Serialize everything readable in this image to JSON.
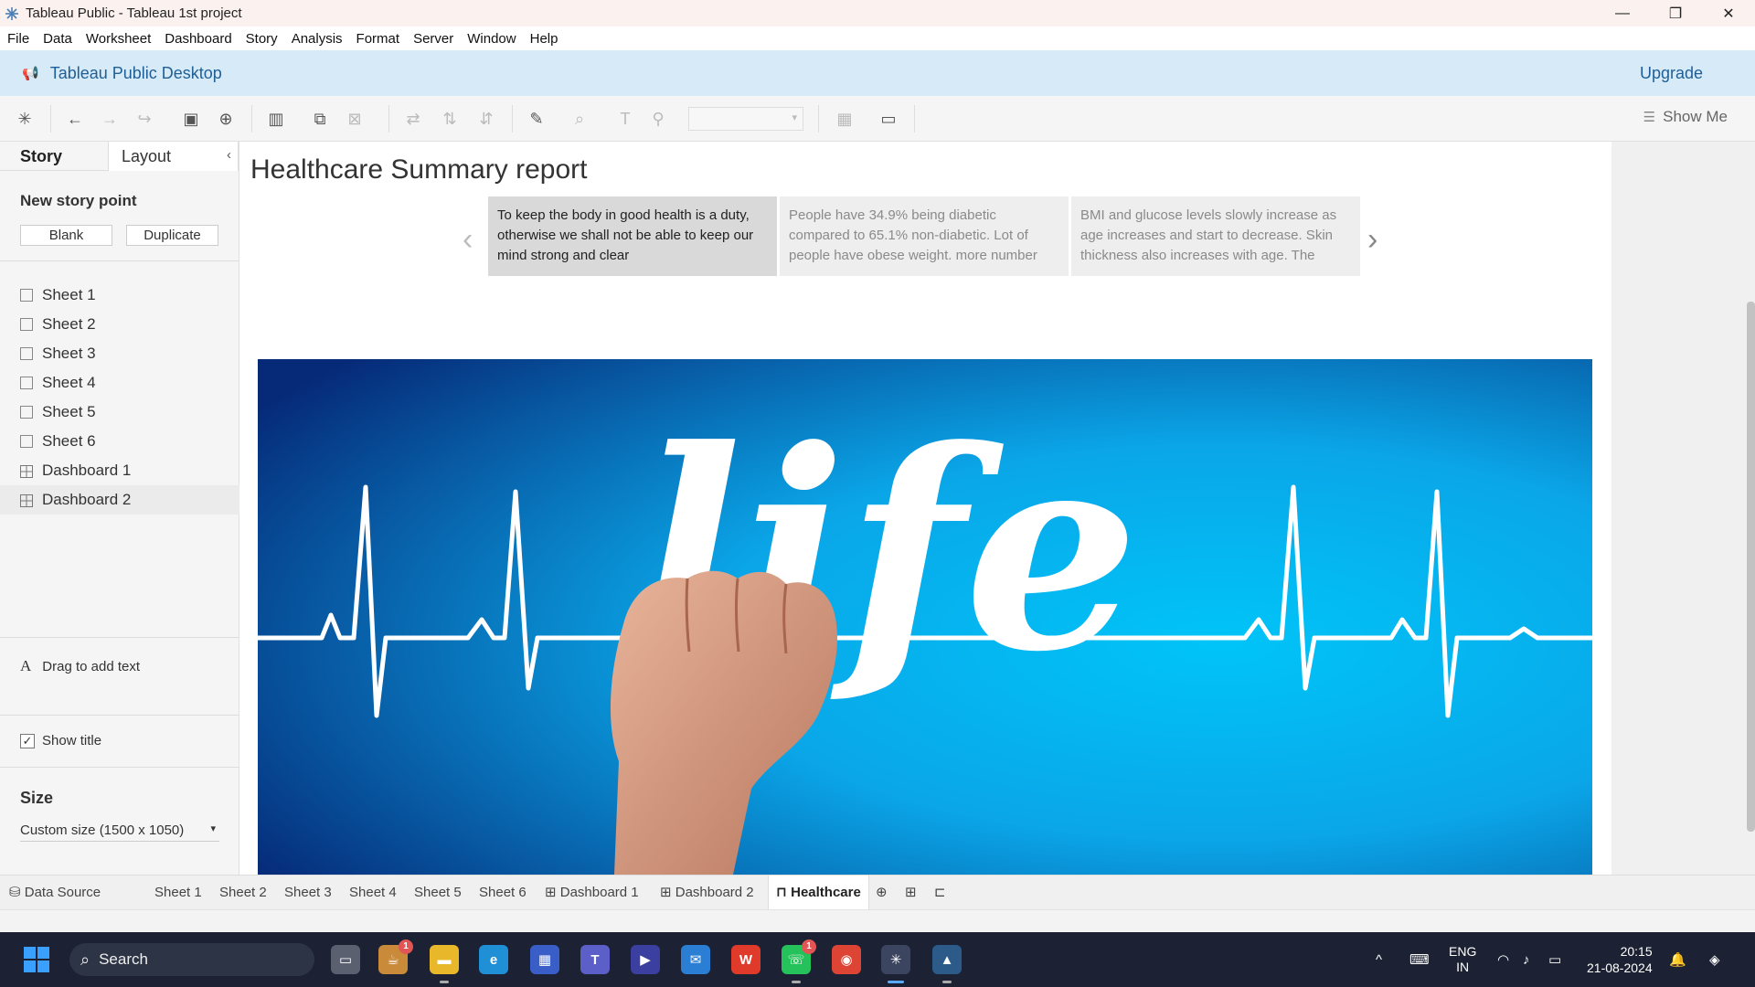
{
  "window": {
    "title": "Tableau Public - Tableau 1st project",
    "controls": [
      "minimize",
      "restore",
      "close"
    ]
  },
  "menu": [
    "File",
    "Data",
    "Worksheet",
    "Dashboard",
    "Story",
    "Analysis",
    "Format",
    "Server",
    "Window",
    "Help"
  ],
  "banner": {
    "name": "Tableau Public Desktop",
    "upgrade": "Upgrade"
  },
  "toolbar": {
    "show_me": "Show Me"
  },
  "left_panel": {
    "tabs": [
      "Story",
      "Layout"
    ],
    "new_story_point": "New story point",
    "blank_button": "Blank",
    "duplicate_button": "Duplicate",
    "sheets": [
      {
        "label": "Sheet 1",
        "type": "worksheet"
      },
      {
        "label": "Sheet 2",
        "type": "worksheet"
      },
      {
        "label": "Sheet 3",
        "type": "worksheet"
      },
      {
        "label": "Sheet 4",
        "type": "worksheet"
      },
      {
        "label": "Sheet 5",
        "type": "worksheet"
      },
      {
        "label": "Sheet 6",
        "type": "worksheet"
      },
      {
        "label": "Dashboard 1",
        "type": "dashboard"
      },
      {
        "label": "Dashboard 2",
        "type": "dashboard"
      }
    ],
    "drag_text": "Drag to add text",
    "show_title": "Show title",
    "show_title_checked": true,
    "size_heading": "Size",
    "size_value": "Custom size (1500 x 1050)"
  },
  "story": {
    "title": "Healthcare Summary report",
    "points": [
      {
        "text": "To keep the body in good health is a duty, otherwise we shall not be able to keep our mind strong and clear",
        "active": true
      },
      {
        "text": "People have 34.9% being diabetic compared to 65.1% non-diabetic. Lot of people have obese weight. more number",
        "active": false
      },
      {
        "text": "BMI and glucose levels slowly increase as age increases and start to decrease. Skin thickness also increases with age. The",
        "active": false
      }
    ],
    "image_word": "life"
  },
  "bottom_tabs": [
    {
      "label": "Data Source",
      "active": false
    },
    {
      "label": "Sheet 1",
      "active": false
    },
    {
      "label": "Sheet 2",
      "active": false
    },
    {
      "label": "Sheet 3",
      "active": false
    },
    {
      "label": "Sheet 4",
      "active": false
    },
    {
      "label": "Sheet 5",
      "active": false
    },
    {
      "label": "Sheet 6",
      "active": false
    },
    {
      "label": "Dashboard 1",
      "active": false
    },
    {
      "label": "Dashboard 2",
      "active": false
    },
    {
      "label": "Healthcare",
      "active": true
    }
  ],
  "taskbar": {
    "search": "Search",
    "language": "ENG",
    "region": "IN",
    "time": "20:15",
    "date": "21-08-2024",
    "badges": {
      "widgets": "1",
      "whatsapp": "1"
    }
  },
  "colors": {
    "banner": "#d6eaf8",
    "brand_text": "#1f5f95",
    "taskbar": "#1c2233",
    "image_blue": "#00aaee"
  }
}
